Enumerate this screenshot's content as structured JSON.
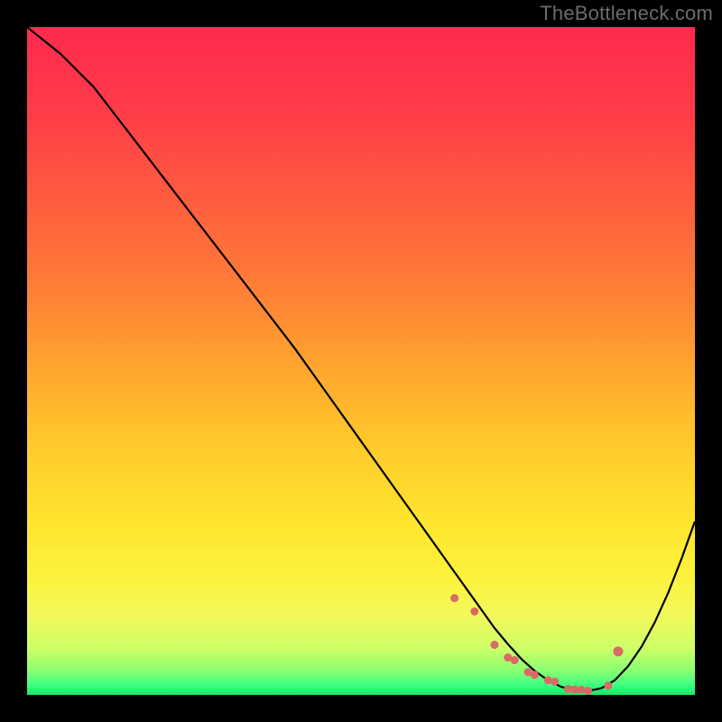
{
  "watermark": "TheBottleneck.com",
  "chart_data": {
    "type": "line",
    "title": "",
    "xlabel": "",
    "ylabel": "",
    "xlim": [
      0,
      100
    ],
    "ylim": [
      0,
      100
    ],
    "curve": {
      "name": "bottleneck-curve",
      "x": [
        0,
        5,
        10,
        15,
        20,
        25,
        30,
        35,
        40,
        45,
        50,
        55,
        60,
        62,
        64,
        66,
        68,
        70,
        72,
        74,
        76,
        78,
        80,
        82,
        84,
        86,
        88,
        90,
        92,
        94,
        96,
        98,
        100
      ],
      "y": [
        100,
        96,
        91,
        84.5,
        78,
        71.5,
        65,
        58.5,
        52,
        45,
        38,
        31,
        24,
        21.2,
        18.4,
        15.6,
        12.8,
        10,
        7.6,
        5.4,
        3.6,
        2.2,
        1.2,
        0.7,
        0.6,
        1,
        2.2,
        4.3,
        7.2,
        10.9,
        15.3,
        20.4,
        26
      ]
    },
    "markers": {
      "name": "optimal-range-markers",
      "color": "#db6a67",
      "x": [
        64,
        67,
        70,
        72,
        73,
        75,
        76,
        78,
        79,
        81,
        82,
        83,
        84,
        87,
        88.5
      ],
      "y": [
        14.5,
        12.5,
        7.5,
        5.6,
        5.2,
        3.4,
        3.0,
        2.2,
        2.0,
        0.9,
        0.8,
        0.8,
        0.6,
        1.4,
        6.5
      ],
      "size": [
        4.5,
        4.5,
        4.5,
        4.5,
        4.5,
        4.5,
        4.5,
        4.5,
        4.5,
        4.5,
        4.5,
        4.5,
        4.5,
        4.5,
        5.5
      ]
    },
    "background_gradient": {
      "stops": [
        {
          "offset": 0.0,
          "color": "#ff2a4e"
        },
        {
          "offset": 0.12,
          "color": "#ff3b49"
        },
        {
          "offset": 0.25,
          "color": "#ff5a3f"
        },
        {
          "offset": 0.38,
          "color": "#ff7b37"
        },
        {
          "offset": 0.5,
          "color": "#ffa22f"
        },
        {
          "offset": 0.62,
          "color": "#ffc82b"
        },
        {
          "offset": 0.73,
          "color": "#ffe22e"
        },
        {
          "offset": 0.82,
          "color": "#fdf23a"
        },
        {
          "offset": 0.88,
          "color": "#f2f85a"
        },
        {
          "offset": 0.93,
          "color": "#ceff67"
        },
        {
          "offset": 0.965,
          "color": "#86ff72"
        },
        {
          "offset": 0.985,
          "color": "#3dff80"
        },
        {
          "offset": 1.0,
          "color": "#13e86a"
        }
      ]
    }
  }
}
